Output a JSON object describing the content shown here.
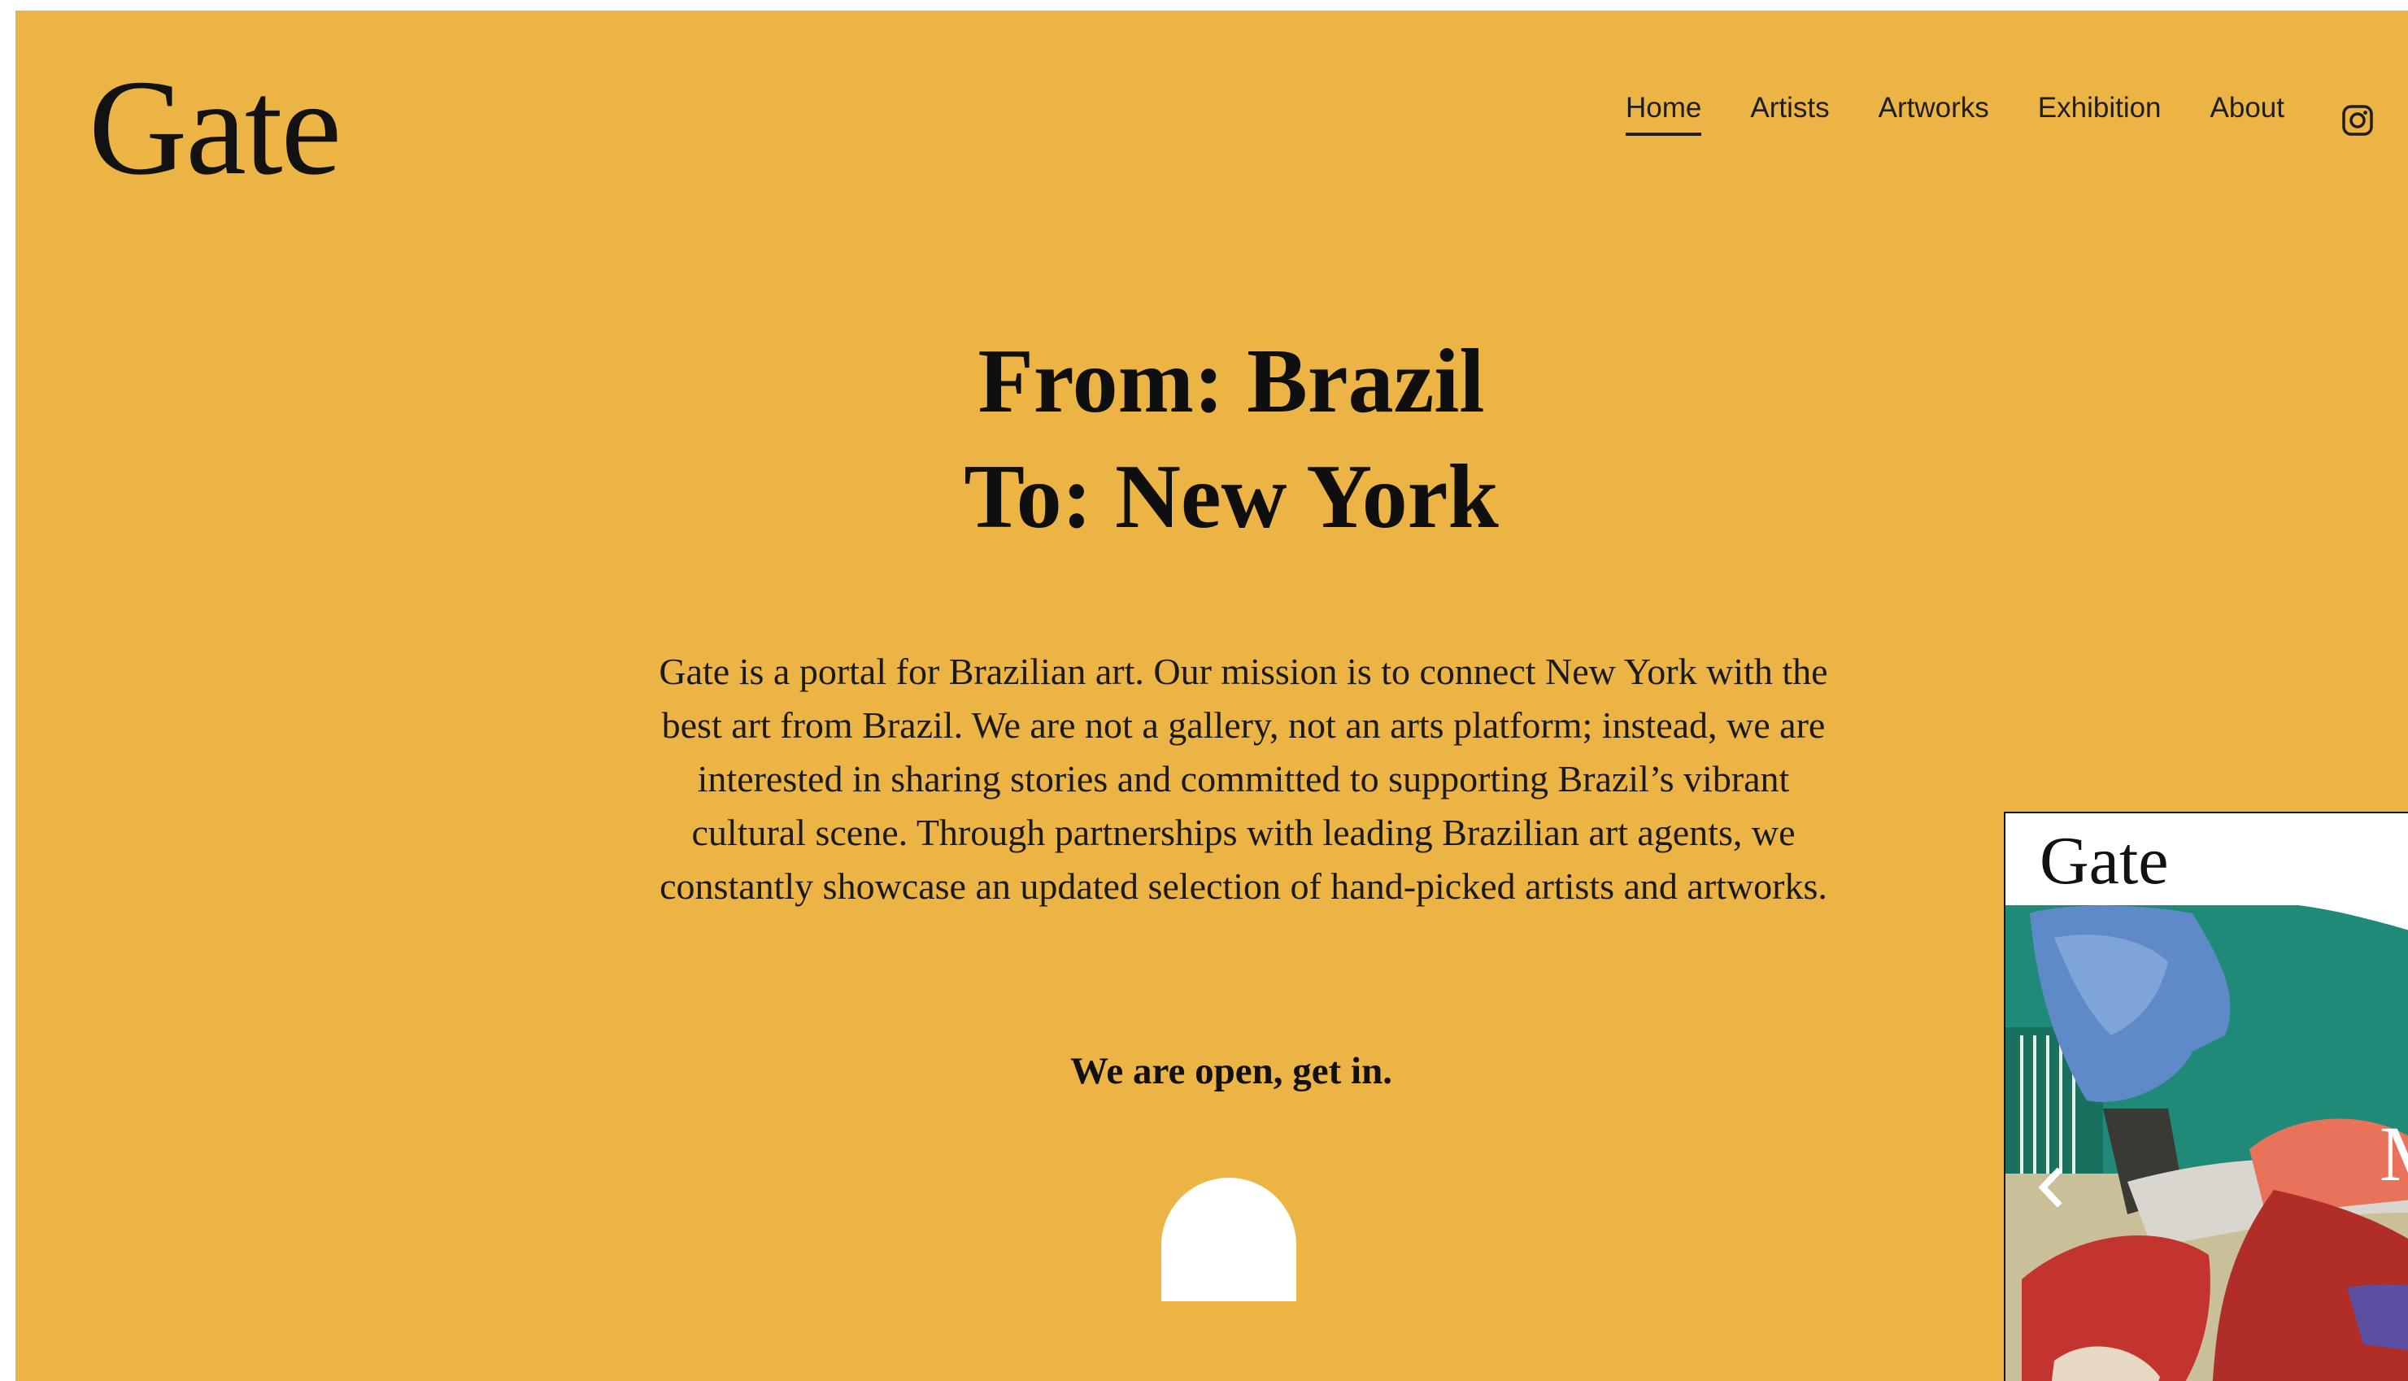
{
  "brand": {
    "logo_text": "Gate"
  },
  "nav": {
    "items": [
      {
        "label": "Home",
        "active": true
      },
      {
        "label": "Artists",
        "active": false
      },
      {
        "label": "Artworks",
        "active": false
      },
      {
        "label": "Exhibition",
        "active": false
      },
      {
        "label": "About",
        "active": false
      }
    ],
    "instagram_icon": "instagram-icon"
  },
  "hero": {
    "line1": "From: Brazil",
    "line2": "To: New York"
  },
  "description": "Gate is a portal for Brazilian art. Our mission is to connect New York with the best art from Brazil. We are not a gallery, not an arts platform; instead, we are interested in sharing stories and committed to supporting Brazil’s vibrant cultural scene. Through partnerships with leading Brazilian art agents, we constantly showcase an updated selection of hand-picked artists and artworks.",
  "cta_text": "We are open, get in.",
  "popup": {
    "logo_text": "Gate",
    "overlay_letter": "M",
    "prev_icon": "chevron-left-icon"
  },
  "colors": {
    "background": "#ebb445",
    "text": "#111111",
    "arch": "#ffffff"
  }
}
